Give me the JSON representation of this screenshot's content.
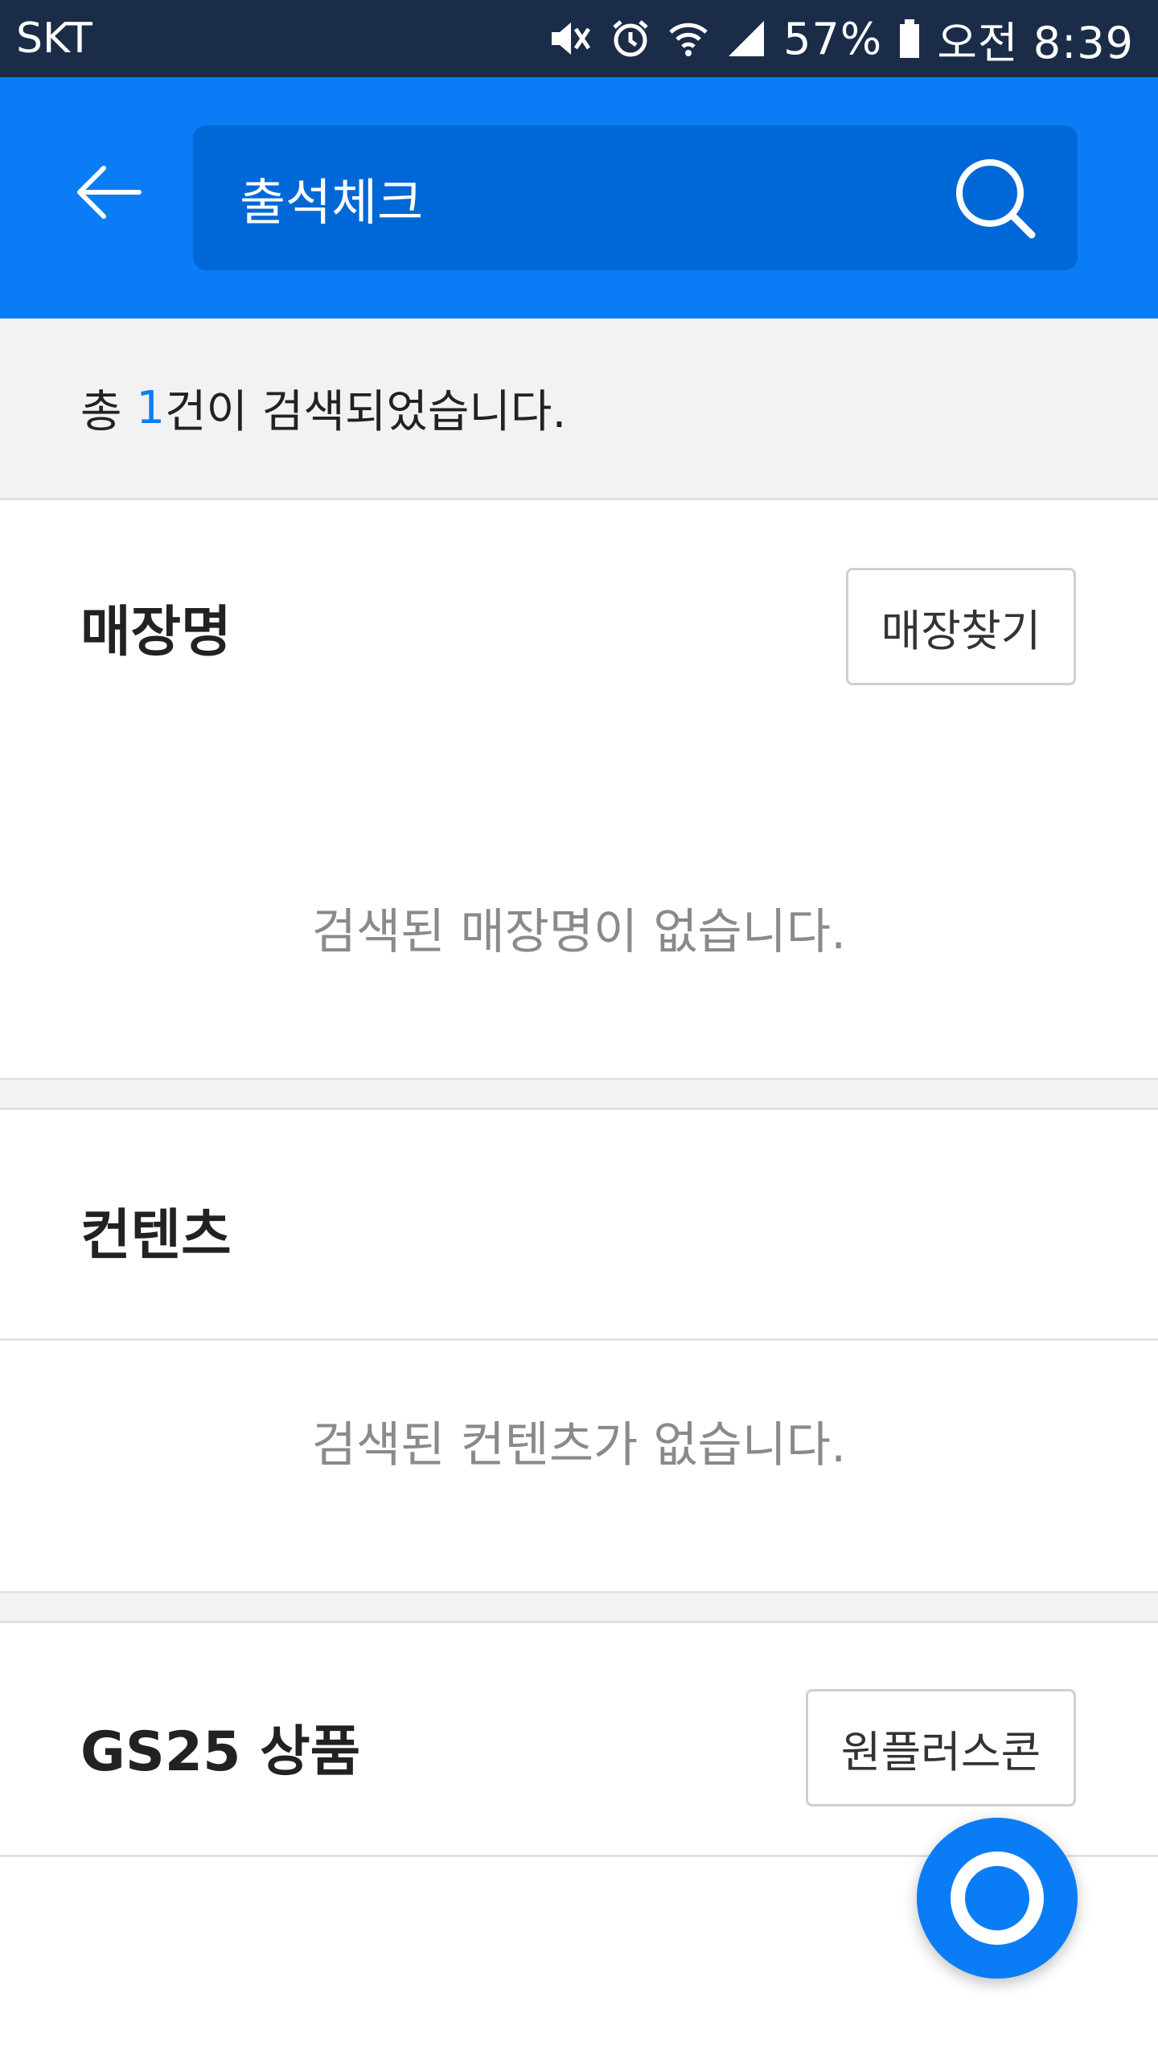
{
  "status_bar": {
    "carrier": "SKT",
    "battery": "57%",
    "time": "오전 8:39"
  },
  "search": {
    "query": "출석체크"
  },
  "results": {
    "prefix": "총 ",
    "count": "1",
    "suffix": "건이 검색되었습니다."
  },
  "store_section": {
    "title": "매장명",
    "button_label": "매장찾기",
    "empty_message": "검색된 매장명이 없습니다."
  },
  "content_section": {
    "title": "컨텐츠",
    "empty_message": "검색된 컨텐츠가 없습니다."
  },
  "product_section": {
    "title": "GS25 상품",
    "button_label": "원플러스콘"
  },
  "colors": {
    "accent": "#0a7df6",
    "status_bar": "#1b2c48",
    "search_field": "#0068d6"
  }
}
